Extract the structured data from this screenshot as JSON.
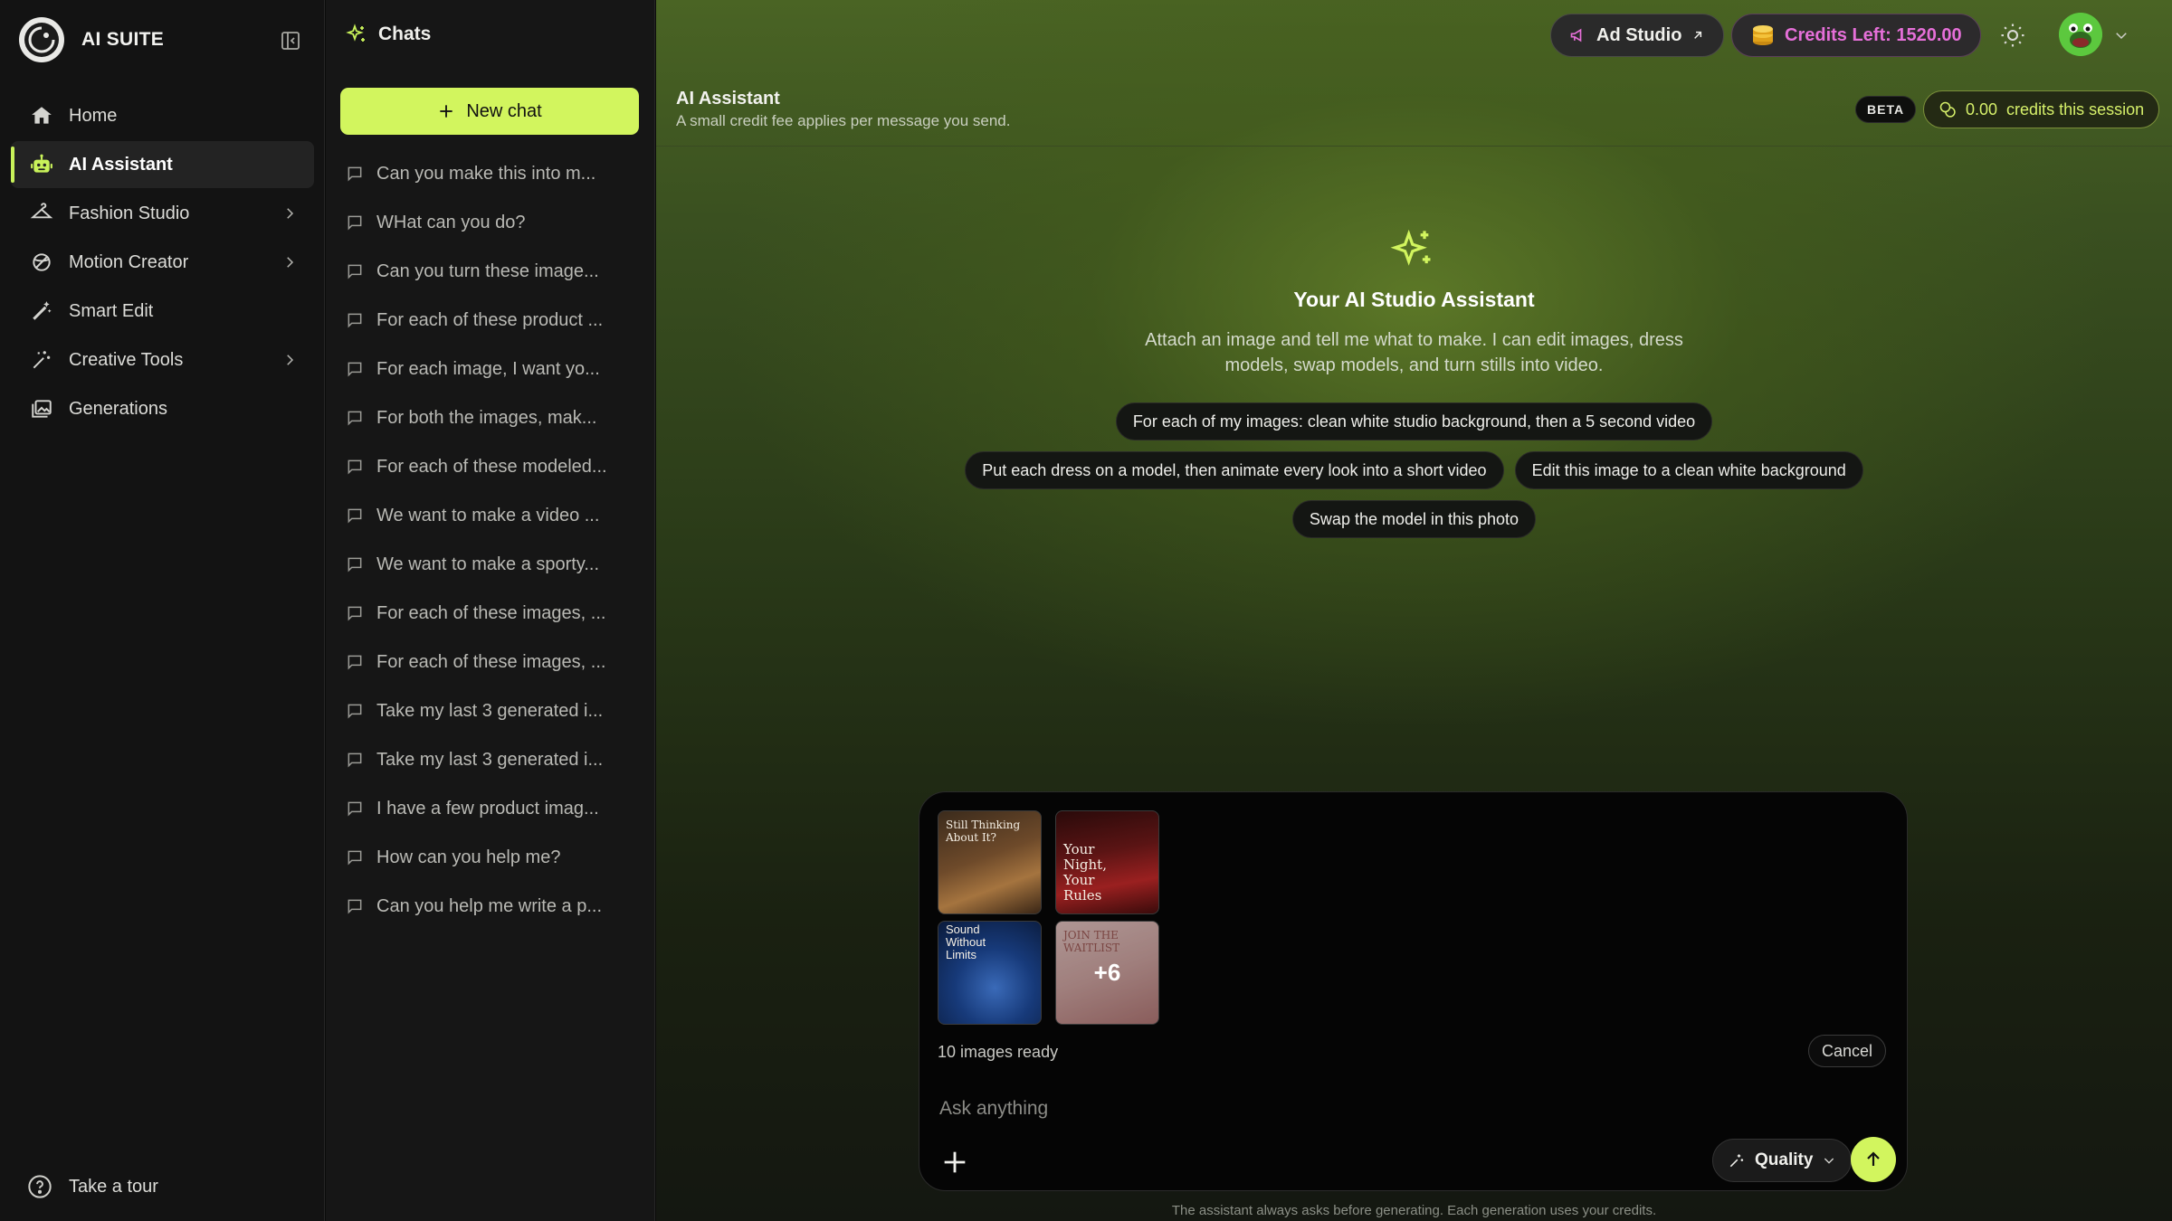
{
  "brand": {
    "name": "AI SUITE"
  },
  "sidebar": {
    "items": [
      {
        "label": "Home",
        "icon": "home-icon"
      },
      {
        "label": "AI Assistant",
        "icon": "robot-icon",
        "active": true
      },
      {
        "label": "Fashion Studio",
        "icon": "hanger-icon",
        "has_submenu": true
      },
      {
        "label": "Motion Creator",
        "icon": "motion-icon",
        "has_submenu": true
      },
      {
        "label": "Smart Edit",
        "icon": "wand-icon"
      },
      {
        "label": "Creative Tools",
        "icon": "sparkle-wand-icon",
        "has_submenu": true
      },
      {
        "label": "Generations",
        "icon": "gallery-icon"
      }
    ],
    "tour_label": "Take a tour"
  },
  "chats": {
    "title": "Chats",
    "new_chat_label": "New chat",
    "items": [
      "Can you make this into m...",
      "WHat can you do?",
      "Can you turn these image...",
      "For each of these product ...",
      "For each image, I want yo...",
      "For both the images, mak...",
      "For each of these modeled...",
      "We want to make a video ...",
      "We want to make a sporty...",
      "For each of these images, ...",
      "For each of these images, ...",
      "Take my last 3 generated i...",
      "Take my last 3 generated i...",
      "I have a few product imag...",
      "How can you help me?",
      "Can you help me write a p..."
    ]
  },
  "topbar": {
    "ad_studio_label": "Ad Studio",
    "credits_label": "Credits Left: 1520.00"
  },
  "header": {
    "title": "AI Assistant",
    "subtitle": "A small credit fee applies per message you send.",
    "beta_label": "BETA",
    "session_credits": "0.00",
    "session_credits_suffix": "credits this session"
  },
  "hero": {
    "title": "Your AI Studio Assistant",
    "description": "Attach an image and tell me what to make. I can edit images, dress models, swap models, and turn stills into video.",
    "suggestions": [
      [
        "For each of my images: clean white studio background, then a 5 second video"
      ],
      [
        "Put each dress on a model, then animate every look into a short video",
        "Edit this image to a clean white background"
      ],
      [
        "Swap the model in this photo"
      ]
    ]
  },
  "composer": {
    "thumbnails": [
      {
        "caption": "Still Thinking About It?"
      },
      {
        "caption": "Your Night, Your Rules"
      },
      {
        "caption": "Sound Without Limits"
      },
      {
        "caption": "JOIN THE WAITLIST",
        "overlay": "+6"
      }
    ],
    "status": "10 images ready",
    "cancel_label": "Cancel",
    "placeholder": "Ask anything",
    "quality_label": "Quality"
  },
  "footnote": "The assistant always asks before generating. Each generation uses your credits.",
  "colors": {
    "accent": "#d2f55e",
    "credits": "#e56fd8"
  }
}
